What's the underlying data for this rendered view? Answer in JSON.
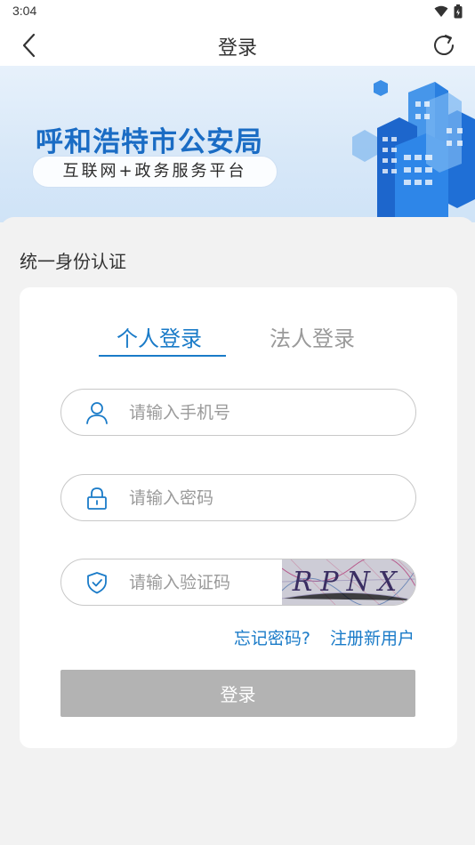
{
  "status_bar": {
    "time": "3:04"
  },
  "nav": {
    "title": "登录",
    "back_icon": "chevron-left-icon",
    "refresh_icon": "refresh-icon"
  },
  "banner": {
    "title": "呼和浩特市公安局",
    "subtitle": "互联网+政务服务平台"
  },
  "section": {
    "title": "统一身份认证"
  },
  "tabs": [
    {
      "label": "个人登录",
      "active": true
    },
    {
      "label": "法人登录",
      "active": false
    }
  ],
  "fields": {
    "phone": {
      "placeholder": "请输入手机号",
      "value": "",
      "icon": "user-icon"
    },
    "password": {
      "placeholder": "请输入密码",
      "value": "",
      "icon": "lock-icon"
    },
    "captcha": {
      "placeholder": "请输入验证码",
      "value": "",
      "icon": "shield-check-icon",
      "image_text": "RPNX"
    }
  },
  "links": {
    "forgot": "忘记密码?",
    "register": "注册新用户"
  },
  "login_button": {
    "label": "登录"
  },
  "colors": {
    "accent": "#1a7bc8",
    "banner_title": "#1a6cc4",
    "button_disabled": "#b3b3b3",
    "background": "#f2f2f2"
  }
}
